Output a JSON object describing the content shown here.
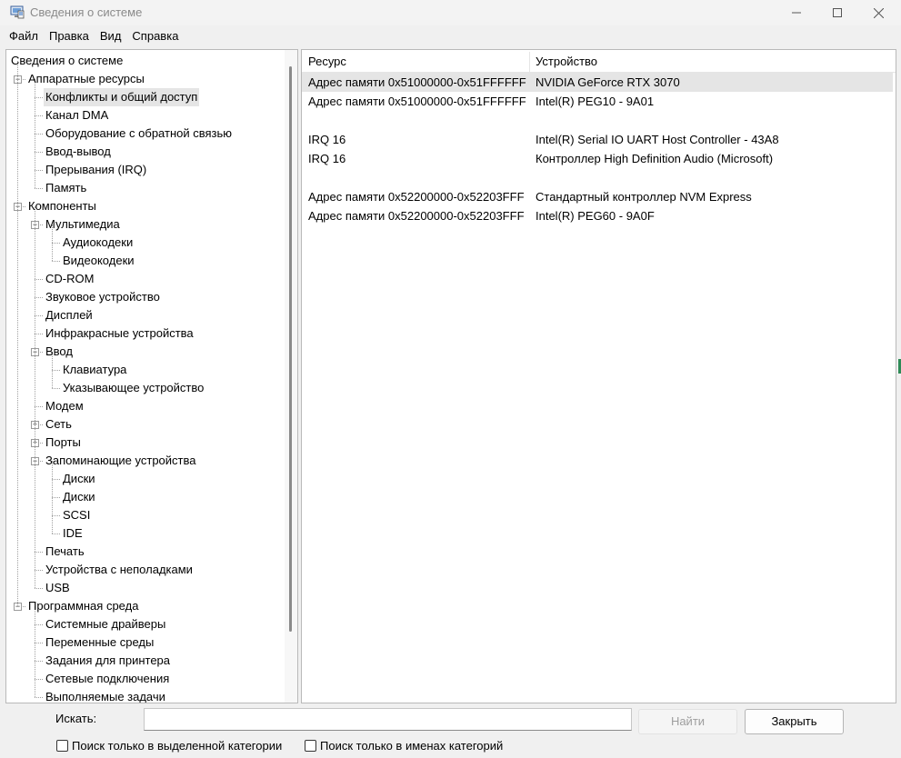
{
  "window": {
    "title": "Сведения о системе"
  },
  "menu": [
    "Файл",
    "Правка",
    "Вид",
    "Справка"
  ],
  "tree": [
    {
      "label": "Сведения о системе",
      "level": 0,
      "expander": "none"
    },
    {
      "label": "Аппаратные ресурсы",
      "level": 1,
      "expander": "minus"
    },
    {
      "label": "Конфликты и общий доступ",
      "level": 2,
      "expander": "none",
      "selected": true
    },
    {
      "label": "Канал DMA",
      "level": 2,
      "expander": "none"
    },
    {
      "label": "Оборудование с обратной связью",
      "level": 2,
      "expander": "none"
    },
    {
      "label": "Ввод-вывод",
      "level": 2,
      "expander": "none"
    },
    {
      "label": "Прерывания (IRQ)",
      "level": 2,
      "expander": "none"
    },
    {
      "label": "Память",
      "level": 2,
      "expander": "none"
    },
    {
      "label": "Компоненты",
      "level": 1,
      "expander": "minus"
    },
    {
      "label": "Мультимедиа",
      "level": 2,
      "expander": "minus"
    },
    {
      "label": "Аудиокодеки",
      "level": 3,
      "expander": "none"
    },
    {
      "label": "Видеокодеки",
      "level": 3,
      "expander": "none"
    },
    {
      "label": "CD-ROM",
      "level": 2,
      "expander": "none"
    },
    {
      "label": "Звуковое устройство",
      "level": 2,
      "expander": "none"
    },
    {
      "label": "Дисплей",
      "level": 2,
      "expander": "none"
    },
    {
      "label": "Инфракрасные устройства",
      "level": 2,
      "expander": "none"
    },
    {
      "label": "Ввод",
      "level": 2,
      "expander": "minus"
    },
    {
      "label": "Клавиатура",
      "level": 3,
      "expander": "none"
    },
    {
      "label": "Указывающее устройство",
      "level": 3,
      "expander": "none"
    },
    {
      "label": "Модем",
      "level": 2,
      "expander": "none"
    },
    {
      "label": "Сеть",
      "level": 2,
      "expander": "plus"
    },
    {
      "label": "Порты",
      "level": 2,
      "expander": "plus"
    },
    {
      "label": "Запоминающие устройства",
      "level": 2,
      "expander": "minus"
    },
    {
      "label": "Диски",
      "level": 3,
      "expander": "none"
    },
    {
      "label": "Диски",
      "level": 3,
      "expander": "none"
    },
    {
      "label": "SCSI",
      "level": 3,
      "expander": "none"
    },
    {
      "label": "IDE",
      "level": 3,
      "expander": "none"
    },
    {
      "label": "Печать",
      "level": 2,
      "expander": "none"
    },
    {
      "label": "Устройства с неполадками",
      "level": 2,
      "expander": "none"
    },
    {
      "label": "USB",
      "level": 2,
      "expander": "none"
    },
    {
      "label": "Программная среда",
      "level": 1,
      "expander": "minus"
    },
    {
      "label": "Системные драйверы",
      "level": 2,
      "expander": "none"
    },
    {
      "label": "Переменные среды",
      "level": 2,
      "expander": "none"
    },
    {
      "label": "Задания для принтера",
      "level": 2,
      "expander": "none"
    },
    {
      "label": "Сетевые подключения",
      "level": 2,
      "expander": "none"
    },
    {
      "label": "Выполняемые задачи",
      "level": 2,
      "expander": "none"
    }
  ],
  "list": {
    "columns": [
      "Ресурс",
      "Устройство"
    ],
    "rows": [
      {
        "resource": "Адрес памяти 0x51000000-0x51FFFFFF",
        "device": "NVIDIA GeForce RTX 3070",
        "highlight": true
      },
      {
        "resource": "Адрес памяти 0x51000000-0x51FFFFFF",
        "device": "Intel(R) PEG10 - 9A01"
      },
      {
        "resource": "",
        "device": ""
      },
      {
        "resource": "IRQ 16",
        "device": "Intel(R) Serial IO UART Host Controller - 43A8"
      },
      {
        "resource": "IRQ 16",
        "device": "Контроллер High Definition Audio (Microsoft)"
      },
      {
        "resource": "",
        "device": ""
      },
      {
        "resource": "Адрес памяти 0x52200000-0x52203FFF",
        "device": "Стандартный контроллер NVM Express"
      },
      {
        "resource": "Адрес памяти 0x52200000-0x52203FFF",
        "device": "Intel(R) PEG60 - 9A0F"
      }
    ]
  },
  "search": {
    "label": "Искать:",
    "value": "",
    "find_button": "Найти",
    "close_button": "Закрыть",
    "option_selected_category": "Поиск только в выделенной категории",
    "option_category_names": "Поиск только в именах категорий"
  }
}
